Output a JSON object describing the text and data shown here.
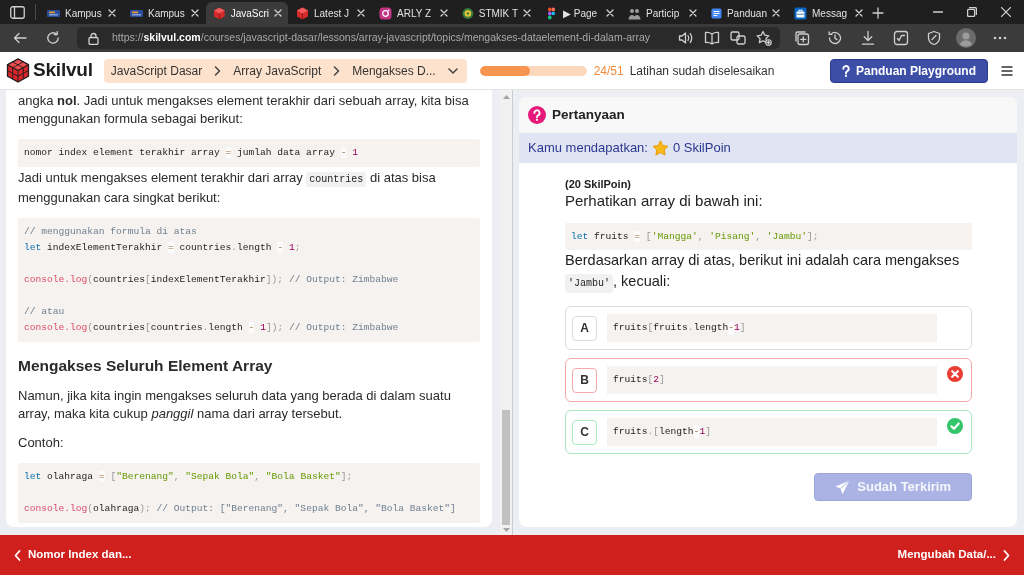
{
  "browser": {
    "tabs": [
      {
        "title": "Kampus",
        "selected": false
      },
      {
        "title": "Kampus",
        "selected": false
      },
      {
        "title": "JavaScri",
        "selected": true
      },
      {
        "title": "Latest J",
        "selected": false
      },
      {
        "title": "ARLY Z",
        "selected": false
      },
      {
        "title": "STMIK T",
        "selected": false
      },
      {
        "title": "▶ Page",
        "selected": false
      },
      {
        "title": "Particip",
        "selected": false
      },
      {
        "title": "Panduan",
        "selected": false
      },
      {
        "title": "Messag",
        "selected": false
      }
    ],
    "address_bar": {
      "url": "https://**skilvul.com**/courses/javascript-dasar/lessons/array-javascript/topics/mengakses-dataelement-di-dalam-array"
    }
  },
  "header": {
    "logo_text": "Skilvul",
    "breadcrumb": [
      "JavaScript Dasar",
      "Array JavaScript",
      "Mengakses D..."
    ],
    "progress": {
      "level": 0.47,
      "count": "24/51",
      "caption": "Latihan sudah diselesaikan"
    },
    "help_button": "Panduan Playground"
  },
  "lesson": {
    "blocks": [
      {
        "kind": "paragraph",
        "parts": [
          {
            "kind": "text",
            "text": "angka **nol**. Jadi untuk mengakses element terakhir dari sebuah array, kita bisa menggunakan formula sebagai berikut:"
          }
        ]
      },
      {
        "kind": "code",
        "groups": [
          [
            [
              {
                "text": "nomor index element terakhir array ",
                "kind": "p"
              },
              {
                "text": "=",
                "kind": "op"
              },
              {
                "text": " jumlah data array ",
                "kind": "p"
              },
              {
                "text": "-",
                "kind": "op"
              },
              {
                "text": " 1",
                "kind": "n"
              }
            ]
          ]
        ]
      },
      {
        "kind": "paragraph",
        "parts": [
          {
            "kind": "text",
            "text": "Jadi untuk mengakses element terakhir dari array "
          },
          {
            "kind": "code",
            "text": "countries"
          },
          {
            "kind": "text",
            "text": " di atas bisa menggunakan cara singkat berikut:"
          }
        ]
      },
      {
        "kind": "code",
        "groups": [
          [
            [
              {
                "text": "// menggunakan formula di atas",
                "kind": "c"
              }
            ],
            [
              {
                "text": "let",
                "kind": "kw"
              },
              {
                "text": " indexElementTerakhir ",
                "kind": "p"
              },
              {
                "text": "=",
                "kind": "op"
              },
              {
                "text": " countries",
                "kind": "p"
              },
              {
                "text": ".",
                "kind": "pu"
              },
              {
                "text": "length ",
                "kind": "p"
              },
              {
                "text": "-",
                "kind": "op"
              },
              {
                "text": " 1",
                "kind": "n"
              },
              {
                "text": ";",
                "kind": "pu"
              }
            ]
          ],
          [
            [
              {
                "text": "console.log",
                "kind": "fn"
              },
              {
                "text": "(",
                "kind": "pu"
              },
              {
                "text": "countries",
                "kind": "p"
              },
              {
                "text": "[",
                "kind": "pu"
              },
              {
                "text": "indexElementTerakhir",
                "kind": "p"
              },
              {
                "text": "]);",
                "kind": "pu"
              },
              {
                "text": " // Output: Zimbabwe",
                "kind": "c"
              }
            ]
          ],
          [
            [
              {
                "text": "// atau",
                "kind": "c"
              }
            ],
            [
              {
                "text": "console.log",
                "kind": "fn"
              },
              {
                "text": "(",
                "kind": "pu"
              },
              {
                "text": "countries",
                "kind": "p"
              },
              {
                "text": "[",
                "kind": "pu"
              },
              {
                "text": "countries",
                "kind": "p"
              },
              {
                "text": ".",
                "kind": "pu"
              },
              {
                "text": "length ",
                "kind": "p"
              },
              {
                "text": "-",
                "kind": "op"
              },
              {
                "text": " 1",
                "kind": "n"
              },
              {
                "text": "]);",
                "kind": "pu"
              },
              {
                "text": " // Output: Zimbabwe",
                "kind": "c"
              }
            ]
          ]
        ]
      },
      {
        "kind": "heading",
        "parts": [
          {
            "kind": "text",
            "text": "Mengakses Seluruh Element Array"
          }
        ]
      },
      {
        "kind": "paragraph",
        "parts": [
          {
            "kind": "text",
            "text": "Namun, jika kita ingin mengakses seluruh data yang berada di dalam suatu array, maka kita cukup *panggil* nama dari array tersebut."
          }
        ]
      },
      {
        "kind": "paragraph",
        "parts": [
          {
            "kind": "text",
            "text": "Contoh:"
          }
        ]
      },
      {
        "kind": "code",
        "groups": [
          [
            [
              {
                "text": "let",
                "kind": "kw"
              },
              {
                "text": " olahraga ",
                "kind": "p"
              },
              {
                "text": "=",
                "kind": "op"
              },
              {
                "text": " [",
                "kind": "pu"
              },
              {
                "text": "\"Berenang\"",
                "kind": "s"
              },
              {
                "text": ", ",
                "kind": "pu"
              },
              {
                "text": "\"Sepak Bola\"",
                "kind": "s"
              },
              {
                "text": ", ",
                "kind": "pu"
              },
              {
                "text": "\"Bola Basket\"",
                "kind": "s"
              },
              {
                "text": "];",
                "kind": "pu"
              }
            ]
          ],
          [
            [
              {
                "text": "console.log",
                "kind": "fn"
              },
              {
                "text": "(",
                "kind": "pu"
              },
              {
                "text": "olahraga",
                "kind": "p"
              },
              {
                "text": ");",
                "kind": "pu"
              },
              {
                "text": " // Output: [\"Berenang\", \"Sepak Bola\", \"Bola Basket\"]",
                "kind": "c"
              }
            ]
          ]
        ]
      }
    ]
  },
  "question": {
    "title": "Pertanyaan",
    "reward_label": "Kamu mendapatkan:",
    "reward_value": "0 SkilPoin",
    "points": "(20 SkilPoin)",
    "prompt": "Perhatikan array di bawah ini:",
    "code": [
      {
        "text": "let",
        "kind": "kw"
      },
      {
        "text": " fruits ",
        "kind": "p"
      },
      {
        "text": "=",
        "kind": "op"
      },
      {
        "text": " [",
        "kind": "pu"
      },
      {
        "text": "'Mangga'",
        "kind": "s"
      },
      {
        "text": ", ",
        "kind": "pu"
      },
      {
        "text": "'Pisang'",
        "kind": "s"
      },
      {
        "text": ", ",
        "kind": "pu"
      },
      {
        "text": "'Jambu'",
        "kind": "s"
      },
      {
        "text": "];",
        "kind": "pu"
      }
    ],
    "text": [
      {
        "kind": "text",
        "text": "Berdasarkan array di atas, berikut ini adalah cara mengakses "
      },
      {
        "kind": "code",
        "text": "'Jambu'"
      },
      {
        "kind": "text",
        "text": ", kecuali:"
      }
    ],
    "options": [
      {
        "letter": "A",
        "selected": false,
        "correct": false,
        "code": [
          {
            "text": "fruits",
            "kind": "p"
          },
          {
            "text": "[",
            "kind": "pu"
          },
          {
            "text": "fruits",
            "kind": "p"
          },
          {
            "text": ".",
            "kind": "pu"
          },
          {
            "text": "length",
            "kind": "p"
          },
          {
            "text": "-",
            "kind": "op"
          },
          {
            "text": "1",
            "kind": "n"
          },
          {
            "text": "]",
            "kind": "pu"
          }
        ]
      },
      {
        "letter": "B",
        "selected": true,
        "correct": false,
        "code": [
          {
            "text": "fruits",
            "kind": "p"
          },
          {
            "text": "[",
            "kind": "pu"
          },
          {
            "text": "2",
            "kind": "n"
          },
          {
            "text": "]",
            "kind": "pu"
          }
        ]
      },
      {
        "letter": "C",
        "selected": false,
        "correct": true,
        "code": [
          {
            "text": "fruits",
            "kind": "p"
          },
          {
            "text": ".[",
            "kind": "pu"
          },
          {
            "text": "length",
            "kind": "p"
          },
          {
            "text": "-",
            "kind": "op"
          },
          {
            "text": "1",
            "kind": "n"
          },
          {
            "text": "]",
            "kind": "pu"
          }
        ]
      }
    ],
    "submit_button": {
      "label": "Sudah Terkirim",
      "disabled": true
    }
  },
  "footer": {
    "previous": "Nomor Index dan...",
    "next": "Mengubah Data/..."
  }
}
